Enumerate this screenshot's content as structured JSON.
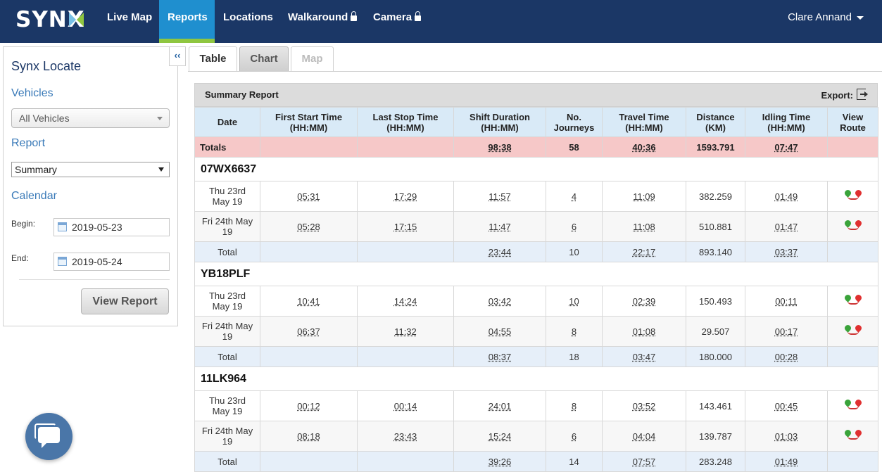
{
  "nav": {
    "logo": "SYNX",
    "items": [
      {
        "label": "Live Map",
        "active": false,
        "locked": false
      },
      {
        "label": "Reports",
        "active": true,
        "locked": false
      },
      {
        "label": "Locations",
        "active": false,
        "locked": false
      },
      {
        "label": "Walkaround",
        "active": false,
        "locked": true
      },
      {
        "label": "Camera",
        "active": false,
        "locked": true
      }
    ],
    "user": "Clare Annand"
  },
  "sidebar": {
    "collapse_label": "‹‹",
    "title": "Synx Locate",
    "vehicles_label": "Vehicles",
    "vehicles_value": "All Vehicles",
    "report_label": "Report",
    "report_value": "Summary",
    "calendar_label": "Calendar",
    "begin_label": "Begin:",
    "begin_value": "2019-05-23",
    "end_label": "End:",
    "end_value": "2019-05-24",
    "view_report": "View Report"
  },
  "tabs": [
    {
      "label": "Table",
      "state": "active"
    },
    {
      "label": "Chart",
      "state": "normal"
    },
    {
      "label": "Map",
      "state": "disabled"
    }
  ],
  "report": {
    "title": "Summary Report",
    "export_label": "Export:",
    "columns": [
      {
        "line1": "Date",
        "line2": ""
      },
      {
        "line1": "First Start Time",
        "line2": "(HH:MM)"
      },
      {
        "line1": "Last Stop Time",
        "line2": "(HH:MM)"
      },
      {
        "line1": "Shift Duration",
        "line2": "(HH:MM)"
      },
      {
        "line1": "No.",
        "line2": "Journeys"
      },
      {
        "line1": "Travel Time",
        "line2": "(HH:MM)"
      },
      {
        "line1": "Distance",
        "line2": "(KM)"
      },
      {
        "line1": "Idling Time",
        "line2": "(HH:MM)"
      },
      {
        "line1": "View",
        "line2": "Route"
      }
    ],
    "totals": {
      "label": "Totals",
      "shift": "98:38",
      "journeys": "58",
      "travel": "40:36",
      "distance": "1593.791",
      "idling": "07:47"
    },
    "groups": [
      {
        "vehicle": "07WX6637",
        "rows": [
          {
            "date1": "Thu 23rd",
            "date2": "May 19",
            "start": "05:31",
            "stop": "17:29",
            "shift": "11:57",
            "journeys": "4",
            "travel": "11:09",
            "distance": "382.259",
            "idling": "01:49"
          },
          {
            "date1": "Fri 24th May",
            "date2": "19",
            "start": "05:28",
            "stop": "17:15",
            "shift": "11:47",
            "journeys": "6",
            "travel": "11:08",
            "distance": "510.881",
            "idling": "01:47"
          }
        ],
        "total": {
          "label": "Total",
          "shift": "23:44",
          "journeys": "10",
          "travel": "22:17",
          "distance": "893.140",
          "idling": "03:37"
        }
      },
      {
        "vehicle": "YB18PLF",
        "rows": [
          {
            "date1": "Thu 23rd",
            "date2": "May 19",
            "start": "10:41",
            "stop": "14:24",
            "shift": "03:42",
            "journeys": "10",
            "travel": "02:39",
            "distance": "150.493",
            "idling": "00:11"
          },
          {
            "date1": "Fri 24th May",
            "date2": "19",
            "start": "06:37",
            "stop": "11:32",
            "shift": "04:55",
            "journeys": "8",
            "travel": "01:08",
            "distance": "29.507",
            "idling": "00:17"
          }
        ],
        "total": {
          "label": "Total",
          "shift": "08:37",
          "journeys": "18",
          "travel": "03:47",
          "distance": "180.000",
          "idling": "00:28"
        }
      },
      {
        "vehicle": "11LK964",
        "rows": [
          {
            "date1": "Thu 23rd",
            "date2": "May 19",
            "start": "00:12",
            "stop": "00:14",
            "shift": "24:01",
            "journeys": "8",
            "travel": "03:52",
            "distance": "143.461",
            "idling": "00:45"
          },
          {
            "date1": "Fri 24th May",
            "date2": "19",
            "start": "08:18",
            "stop": "23:43",
            "shift": "15:24",
            "journeys": "6",
            "travel": "04:04",
            "distance": "139.787",
            "idling": "01:03"
          }
        ],
        "total": {
          "label": "Total",
          "shift": "39:26",
          "journeys": "14",
          "travel": "07:57",
          "distance": "283.248",
          "idling": "01:49"
        }
      }
    ]
  },
  "icons": {
    "route": "route-pins-icon",
    "calendar": "calendar-icon",
    "export": "export-icon",
    "chat": "chat-icon",
    "lock": "lock-icon"
  },
  "colors": {
    "nav_bg": "#1b3766",
    "nav_active": "#1f8fcf",
    "nav_active_bar": "#8fc640",
    "header_blue": "#d9eaf7",
    "totals_pink": "#f6c8c8",
    "subtotal_blue": "#e6eff9"
  }
}
